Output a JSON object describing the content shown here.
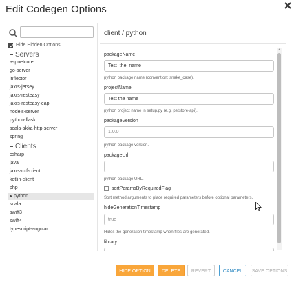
{
  "dialog": {
    "title": "Edit Codegen Options"
  },
  "left_panel": {
    "search": {
      "value": "",
      "placeholder": ""
    },
    "hide_hidden": {
      "label": "Hide Hidden Options",
      "checked": true
    },
    "groups": [
      {
        "label": "Servers",
        "items": [
          "aspnetcore",
          "go-server",
          "inflector",
          "jaxrs-jersey",
          "jaxrs-resteasy",
          "jaxrs-resteasy-eap",
          "nodejs-server",
          "python-flask",
          "scala-akka-http-server",
          "spring"
        ]
      },
      {
        "label": "Clients",
        "items": [
          "csharp",
          "java",
          "jaxrs-cxf-client",
          "kotlin-client",
          "php",
          "python",
          "scala",
          "swift3",
          "swift4",
          "typescript-angular"
        ]
      }
    ],
    "selected": "python"
  },
  "right_panel": {
    "title": "client / python",
    "packageName": {
      "label": "packageName",
      "value": "Test_the_name",
      "help": "python package name (convention: snake_case)."
    },
    "projectName": {
      "label": "projectName",
      "value": "Test the name",
      "help": "python project name in setup.py (e.g. petstore-api)."
    },
    "packageVersion": {
      "label": "packageVersion",
      "placeholder": "1.0.0",
      "help": "python package version."
    },
    "packageUrl": {
      "label": "packageUrl",
      "value": "",
      "help": "python package URL."
    },
    "sortParams": {
      "label": "sortParamsByRequiredFlag",
      "checked": false,
      "help": "Sort method arguments to place required parameters before optional parameters."
    },
    "hideGenerationTimestamp": {
      "label": "hideGenerationTimestamp",
      "placeholder": "true",
      "help": "Hides the generation timestamp when files are generated."
    },
    "library": {
      "label": "library"
    }
  },
  "footer": {
    "hide_option": "HIDE OPTION",
    "delete": "DELETE",
    "revert": "REVERT",
    "cancel": "CANCEL",
    "save_options": "SAVE OPTIONS"
  },
  "colors": {
    "accent_orange": "#f9a63a",
    "accent_blue": "#4aa0d5",
    "selected_bg": "#e6e6e6"
  }
}
